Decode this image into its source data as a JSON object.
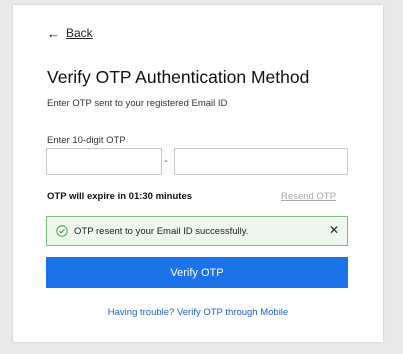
{
  "back": {
    "label": "Back",
    "icon": "arrow-left-icon"
  },
  "title": "Verify OTP Authentication Method",
  "subtitle": "Enter OTP sent to your registered Email ID",
  "otp": {
    "label": "Enter 10-digit OTP",
    "separator": "-",
    "part1_value": "",
    "part2_value": ""
  },
  "expiry_text": "OTP will expire in 01:30 minutes",
  "resend_label": "Resend OTP",
  "alert": {
    "message": "OTP resent to your Email ID successfully.",
    "icon": "check-circle-icon",
    "close_label": "✕",
    "color": "#7cbf7c"
  },
  "verify_button": "Verify OTP",
  "mobile_link": "Having trouble? Verify OTP through Mobile",
  "colors": {
    "accent": "#1a73e8",
    "link": "#1a63c9",
    "success_border": "#7cbf7c",
    "disabled_link": "#a8a8a8"
  }
}
